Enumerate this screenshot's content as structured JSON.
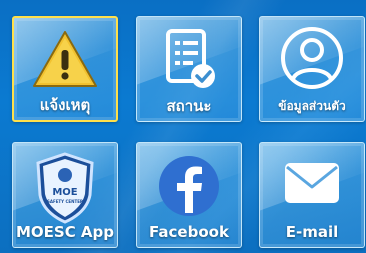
{
  "tiles": [
    {
      "label": "แจ้งเหตุ",
      "icon": "warning-icon"
    },
    {
      "label": "สถานะ",
      "icon": "document-check-icon"
    },
    {
      "label": "ข้อมูลส่วนตัว",
      "icon": "user-profile-icon"
    },
    {
      "label": "MOESC App",
      "icon": "moe-shield-logo-icon"
    },
    {
      "label": "Facebook",
      "icon": "facebook-icon"
    },
    {
      "label": "E-mail",
      "icon": "mail-icon"
    }
  ],
  "logo": {
    "text": "MOE",
    "subtext": "SAFETY CENTER"
  },
  "colors": {
    "background": "#0b7ad1",
    "selected_border": "#ffe04a",
    "warning": "#f2c230"
  }
}
